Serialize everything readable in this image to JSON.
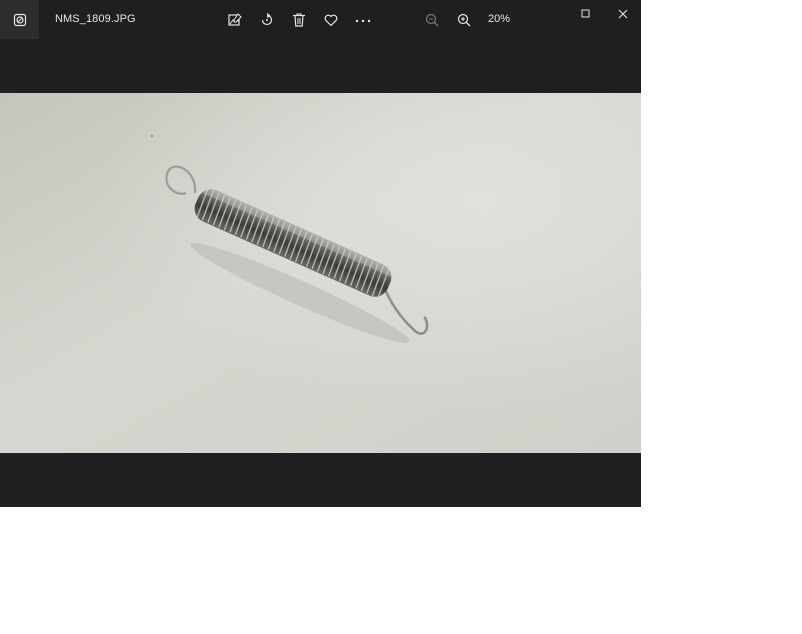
{
  "titlebar": {
    "file_name": "NMS_1809.JPG",
    "zoom_level": "20%"
  },
  "toolbar": {
    "icons": [
      "edit-image-icon",
      "rotate-icon",
      "delete-icon",
      "favorite-icon",
      "more-icon",
      "zoom-out-icon",
      "zoom-in-icon"
    ]
  },
  "window_controls": {
    "icons": [
      "maximize-icon",
      "close-icon"
    ]
  },
  "photo": {
    "subject": "spring-photo"
  },
  "colors": {
    "titlebar_bg": "#1f1f1f",
    "window_bg": "#202020",
    "icon_fg": "#e6e6e6",
    "disabled_fg": "#7a7a7a"
  }
}
